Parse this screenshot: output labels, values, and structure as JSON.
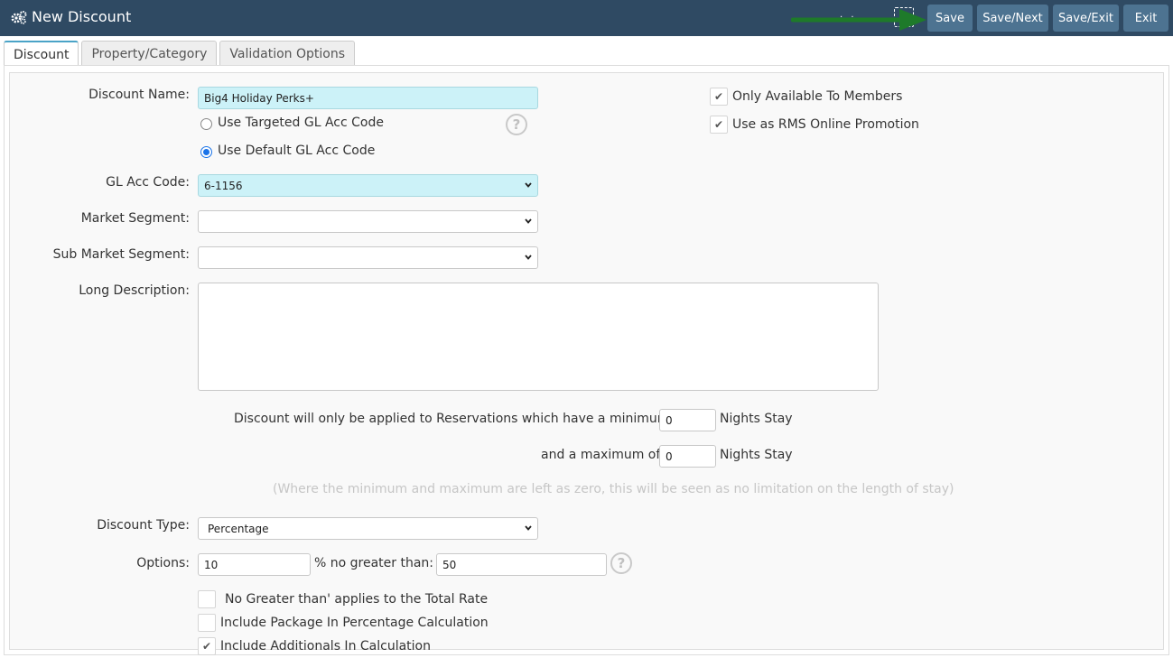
{
  "header": {
    "title": "New Discount",
    "icon": "gears-icon",
    "buttons": {
      "save": "Save",
      "save_next": "Save/Next",
      "save_exit": "Save/Exit",
      "exit": "Exit"
    }
  },
  "tabs": [
    {
      "label": "Discount",
      "active": true
    },
    {
      "label": "Property/Category",
      "active": false
    },
    {
      "label": "Validation Options",
      "active": false
    }
  ],
  "form": {
    "discount_name": {
      "label": "Discount Name:",
      "value": "Big4 Holiday Perks+"
    },
    "gl_radio": {
      "targeted": "Use Targeted GL Acc Code",
      "default": "Use Default GL Acc Code",
      "selected": "default"
    },
    "gl_acc_code": {
      "label": "GL Acc Code:",
      "value": "6-1156"
    },
    "market_segment": {
      "label": "Market Segment:",
      "value": ""
    },
    "sub_market_segment": {
      "label": "Sub Market Segment:",
      "value": ""
    },
    "long_description": {
      "label": "Long Description:",
      "value": ""
    },
    "min_nights": {
      "prefix": "Discount will only be applied to Reservations which have a minimum of",
      "value": "0",
      "suffix": "Nights Stay"
    },
    "max_nights": {
      "prefix": "and a maximum of",
      "value": "0",
      "suffix": "Nights Stay"
    },
    "nights_note": "(Where the minimum and maximum are left as zero, this will be seen as no limitation on the length of stay)",
    "discount_type": {
      "label": "Discount Type:",
      "value": "Percentage"
    },
    "options": {
      "label": "Options:",
      "percent_value": "10",
      "middle_text": "% no greater than: $",
      "max_value": "50"
    },
    "checkboxes": {
      "members_only": {
        "label": "Only Available To Members",
        "checked": true
      },
      "online_promo": {
        "label": "Use as RMS Online Promotion",
        "checked": true
      },
      "no_greater_total": {
        "label": "No Greater than' applies to the Total Rate",
        "checked": false
      },
      "include_package": {
        "label": "Include Package In Percentage Calculation",
        "checked": false
      },
      "include_additionals": {
        "label": "Include Additionals In Calculation",
        "checked": true
      }
    }
  },
  "colors": {
    "header_bg": "#2f4a63",
    "button_bg": "#4d7391",
    "highlight_field": "#ccf2f8",
    "arrow": "#1e7a2a"
  }
}
